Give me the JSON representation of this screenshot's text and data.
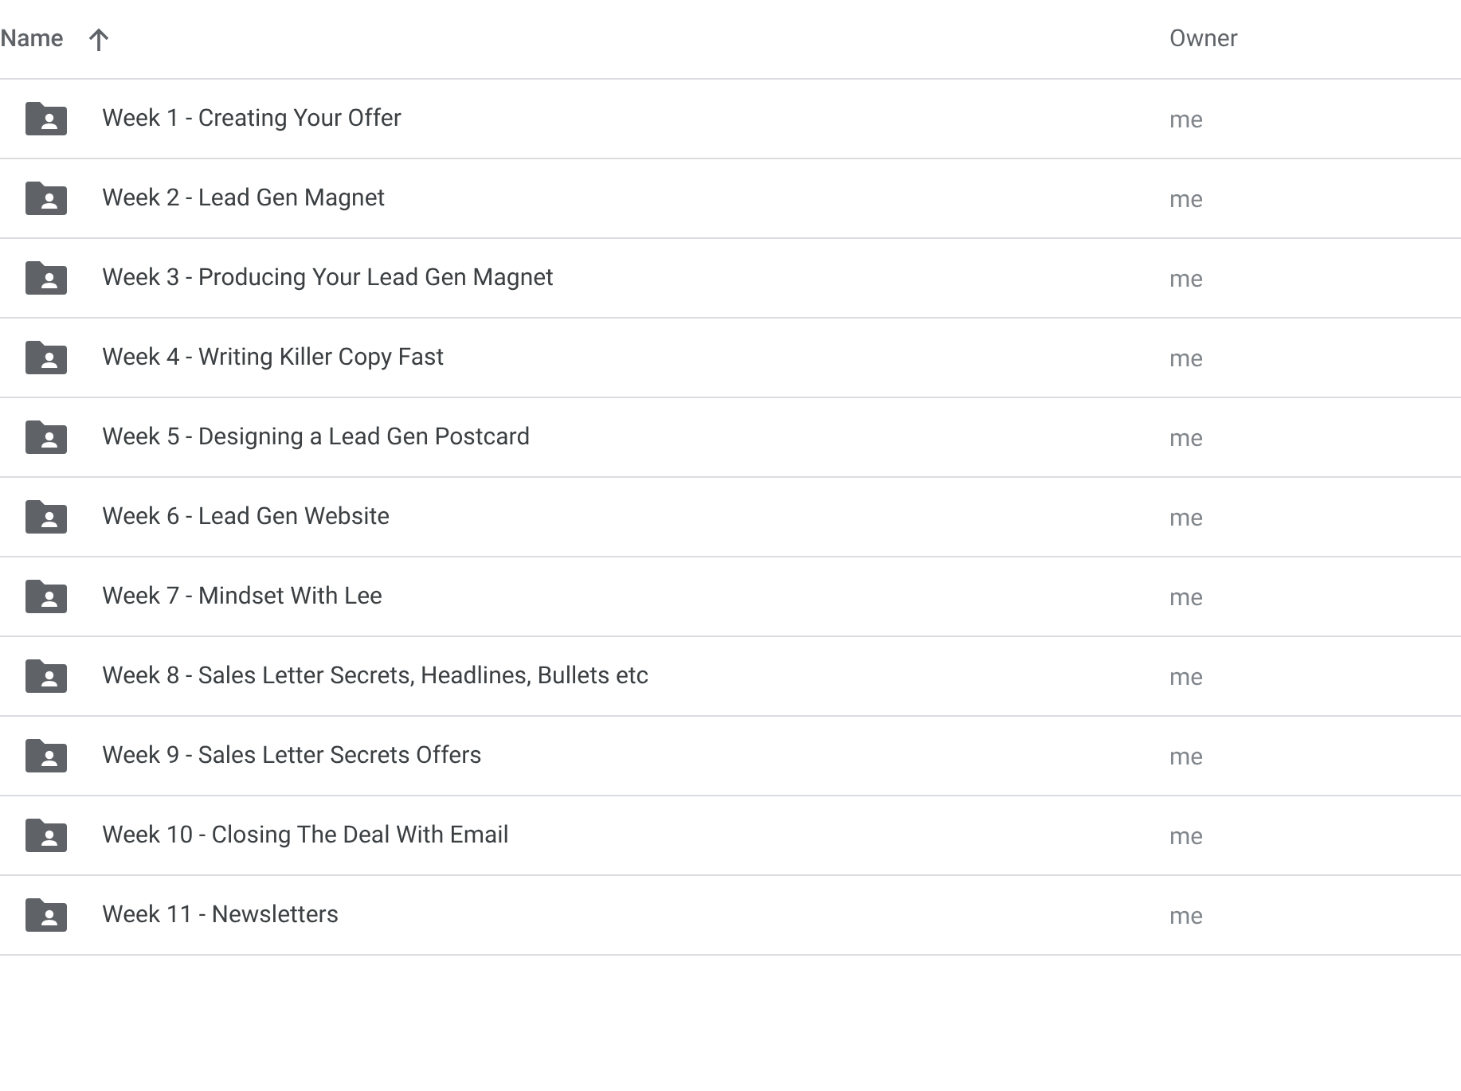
{
  "table": {
    "columns": [
      {
        "label": "Name",
        "sorted": true
      },
      {
        "label": "Owner",
        "sorted": false
      }
    ],
    "rows": [
      {
        "name": "Week 1 - Creating Your Offer",
        "owner": "me"
      },
      {
        "name": "Week 2 - Lead Gen Magnet",
        "owner": "me"
      },
      {
        "name": "Week 3 - Producing Your Lead Gen Magnet",
        "owner": "me"
      },
      {
        "name": "Week 4 - Writing Killer Copy Fast",
        "owner": "me"
      },
      {
        "name": "Week 5 - Designing a Lead Gen Postcard",
        "owner": "me"
      },
      {
        "name": "Week 6 - Lead Gen Website",
        "owner": "me"
      },
      {
        "name": "Week 7 - Mindset With Lee",
        "owner": "me"
      },
      {
        "name": "Week 8 - Sales Letter Secrets, Headlines, Bullets etc",
        "owner": "me"
      },
      {
        "name": "Week 9 - Sales Letter Secrets Offers",
        "owner": "me"
      },
      {
        "name": "Week 10 - Closing The Deal With Email",
        "owner": "me"
      },
      {
        "name": "Week 11 - Newsletters",
        "owner": "me"
      }
    ]
  }
}
